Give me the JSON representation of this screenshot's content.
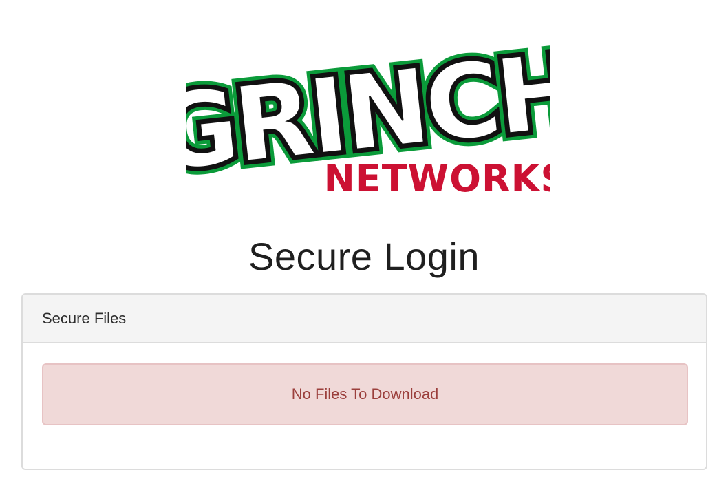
{
  "logo": {
    "alt": "GRINCH NETWORKS",
    "word1": "GRINCH",
    "word2": "NETWORKS",
    "colors": {
      "green": "#0b9b3a",
      "outline": "#111111",
      "fill": "#ffffff",
      "red": "#cc1133"
    }
  },
  "page": {
    "title": "Secure Login"
  },
  "panel": {
    "heading": "Secure Files",
    "alert_text": "No Files To Download",
    "colors": {
      "alert_bg": "#f0d9d8",
      "alert_border": "#e7c3c4",
      "alert_text": "#9b3f3c"
    }
  }
}
